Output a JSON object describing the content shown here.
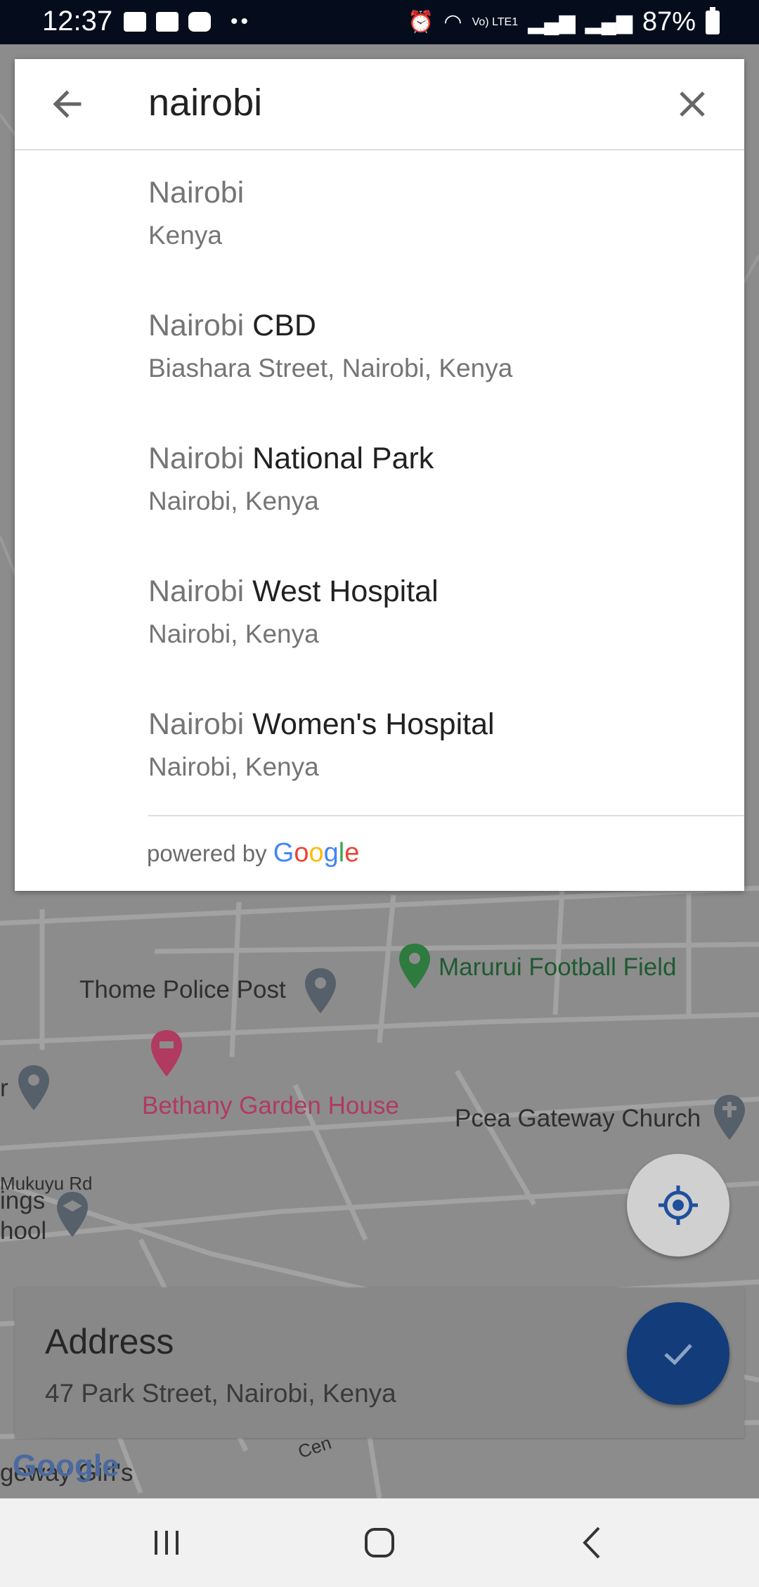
{
  "status_bar": {
    "time": "12:37",
    "network_label": "Vo) LTE1",
    "battery": "87%"
  },
  "search": {
    "query": "nairobi",
    "back_icon": "arrow-left-icon",
    "clear_icon": "close-icon"
  },
  "suggestions": [
    {
      "match": "Nairobi",
      "rest": "",
      "sub": "Kenya"
    },
    {
      "match": "Nairobi",
      "rest": " CBD",
      "sub": "Biashara Street, Nairobi, Kenya"
    },
    {
      "match": "Nairobi",
      "rest": " National Park",
      "sub": "Nairobi, Kenya"
    },
    {
      "match": "Nairobi",
      "rest": " West Hospital",
      "sub": "Nairobi, Kenya"
    },
    {
      "match": "Nairobi",
      "rest": " Women's Hospital",
      "sub": "Nairobi, Kenya"
    }
  ],
  "powered_by": {
    "text": "powered by",
    "logo_letters": [
      "G",
      "o",
      "o",
      "g",
      "l",
      "e"
    ]
  },
  "map": {
    "labels": {
      "marurui": "Marurui Football Field",
      "thome": "Thome Police Post",
      "bethany": "Bethany Garden House",
      "pcea": "Pcea Gateway Church",
      "mukuyu": "Mukuyu Rd",
      "ings": "ings",
      "hool": "hool",
      "r": "r",
      "girls": "geway Girl's",
      "cen": "Cen"
    },
    "google_logo": "Google"
  },
  "address": {
    "title": "Address",
    "value": "47 Park Street, Nairobi, Kenya"
  },
  "colors": {
    "google_blue": "#4285F4",
    "google_red": "#EA4335",
    "google_yellow": "#FBBC05",
    "google_green": "#34A853",
    "confirm_fab": "#123d7a",
    "locate_icon": "#1f4f9c"
  }
}
